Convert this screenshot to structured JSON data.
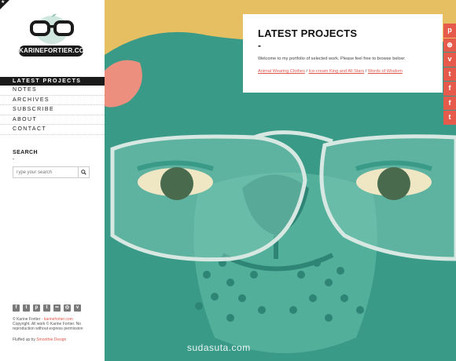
{
  "brand": {
    "logo_text": "KARINEFORTIER.COM"
  },
  "nav": {
    "items": [
      {
        "label": "LATEST PROJECTS"
      },
      {
        "label": "NOTES"
      },
      {
        "label": "ARCHIVES"
      },
      {
        "label": "SUBSCRIBE"
      },
      {
        "label": "ABOUT"
      },
      {
        "label": "CONTACT"
      }
    ]
  },
  "search": {
    "title": "SEARCH",
    "dash": "-",
    "placeholder": "Type your search"
  },
  "footer": {
    "social_icons": [
      "facebook-icon",
      "twitter-icon",
      "pinterest-icon",
      "tumblr-icon",
      "flickr-icon",
      "instagram-icon",
      "vimeo-icon"
    ],
    "copyright_line1": "© Karine Fortier ·",
    "copyright_link": "karinefortier.com",
    "copyright_line2": "Copyright. All work © Karine Fortier. No reproduction without express permission",
    "fluffed_prefix": "Fluffed up by",
    "fluffed_link": "Smoothie.Design"
  },
  "card": {
    "title": "LATEST PROJECTS",
    "dash": "-",
    "text": "Welcome to my portfolio of selected work. Please feel free to browse below:",
    "links": [
      "Animal Wearing Clothes",
      "Ice-cream King and All Stars",
      "Words of Wisdom"
    ],
    "separator": "/"
  },
  "share": {
    "icons": [
      "pinterest-icon",
      "dribbble-icon",
      "vimeo-icon",
      "tumblr-icon",
      "facebook-like-icon",
      "facebook-icon",
      "twitter-icon"
    ],
    "glyphs": [
      "p",
      "⊛",
      "v",
      "t",
      "f",
      "f",
      "t"
    ]
  },
  "watermark": "sudasuta.com",
  "colors": {
    "accent": "#e0584c",
    "sidebar_bg": "#ffffff",
    "hero_teal": "#3a9a88",
    "hero_sky": "#e2b95c"
  }
}
